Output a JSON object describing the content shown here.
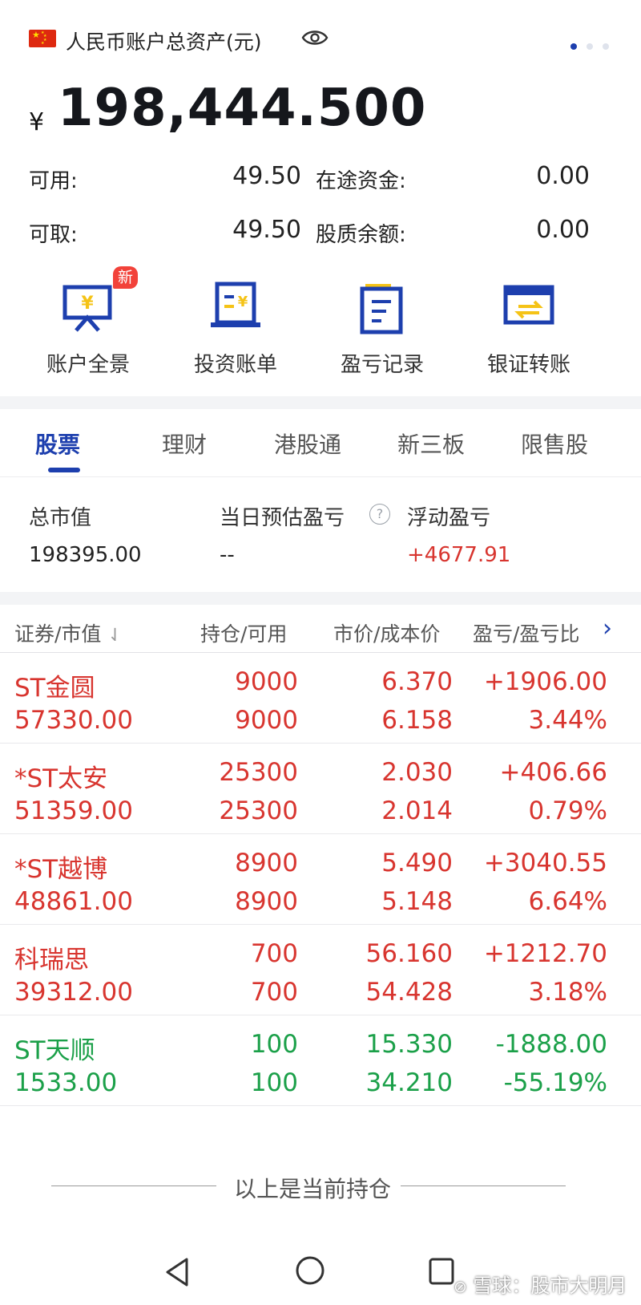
{
  "header": {
    "title": "人民币账户总资产(元)",
    "currency_symbol": "¥",
    "total_assets": "198,444.500"
  },
  "balances": {
    "available_label": "可用:",
    "available_value": "49.50",
    "in_transit_label": "在途资金:",
    "in_transit_value": "0.00",
    "withdrawable_label": "可取:",
    "withdrawable_value": "49.50",
    "pledge_label": "股质余额:",
    "pledge_value": "0.00"
  },
  "functions": [
    {
      "label": "账户全景",
      "badge": "新",
      "icon": "account-overview-icon"
    },
    {
      "label": "投资账单",
      "icon": "investment-bill-icon"
    },
    {
      "label": "盈亏记录",
      "icon": "profit-record-icon"
    },
    {
      "label": "银证转账",
      "icon": "bank-transfer-icon"
    }
  ],
  "tabs": [
    "股票",
    "理财",
    "港股通",
    "新三板",
    "限售股"
  ],
  "summary": {
    "market_value_label": "总市值",
    "market_value": "198395.00",
    "daily_pl_label": "当日预估盈亏",
    "daily_pl": "--",
    "float_pl_label": "浮动盈亏",
    "float_pl": "+4677.91"
  },
  "table": {
    "headers": [
      "证券/市值",
      "持仓/可用",
      "市价/成本价",
      "盈亏/盈亏比"
    ],
    "rows": [
      {
        "name": "ST金圆",
        "value": "57330.00",
        "hold": "9000",
        "avail": "9000",
        "price": "6.370",
        "cost": "6.158",
        "pl": "+1906.00",
        "pct": "3.44%",
        "color": "red"
      },
      {
        "name": "*ST太安",
        "value": "51359.00",
        "hold": "25300",
        "avail": "25300",
        "price": "2.030",
        "cost": "2.014",
        "pl": "+406.66",
        "pct": "0.79%",
        "color": "red"
      },
      {
        "name": "*ST越博",
        "value": "48861.00",
        "hold": "8900",
        "avail": "8900",
        "price": "5.490",
        "cost": "5.148",
        "pl": "+3040.55",
        "pct": "6.64%",
        "color": "red"
      },
      {
        "name": "科瑞思",
        "value": "39312.00",
        "hold": "700",
        "avail": "700",
        "price": "56.160",
        "cost": "54.428",
        "pl": "+1212.70",
        "pct": "3.18%",
        "color": "red"
      },
      {
        "name": "ST天顺",
        "value": "1533.00",
        "hold": "100",
        "avail": "100",
        "price": "15.330",
        "cost": "34.210",
        "pl": "-1888.00",
        "pct": "-55.19%",
        "color": "green"
      }
    ]
  },
  "footer_text": "以上是当前持仓",
  "watermark": "雪球：股市大明月",
  "colors": {
    "accent": "#1d3fae",
    "up": "#d8352f",
    "down": "#1ba049",
    "badge": "#f2423a",
    "icon_yellow": "#f5c316"
  }
}
